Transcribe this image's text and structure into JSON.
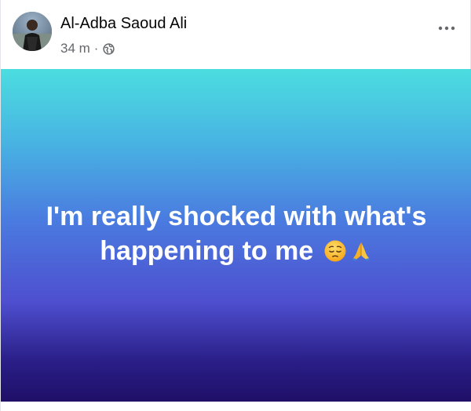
{
  "author": {
    "name": "Al-Adba Saoud Ali",
    "avatar": "avatar-photo"
  },
  "post_meta": {
    "timestamp": "34 m",
    "separator": "·",
    "privacy_icon": "globe-icon"
  },
  "menu": {
    "icon": "more-options-icon"
  },
  "post": {
    "text_line1": "I'm really shocked with what's",
    "text_line2": "happening to me",
    "emojis": [
      "pensive-face-emoji",
      "folded-hands-emoji"
    ]
  },
  "colors": {
    "gradient_top": "#4bdde0",
    "gradient_bottom": "#1f0f67",
    "text": "#ffffff"
  }
}
